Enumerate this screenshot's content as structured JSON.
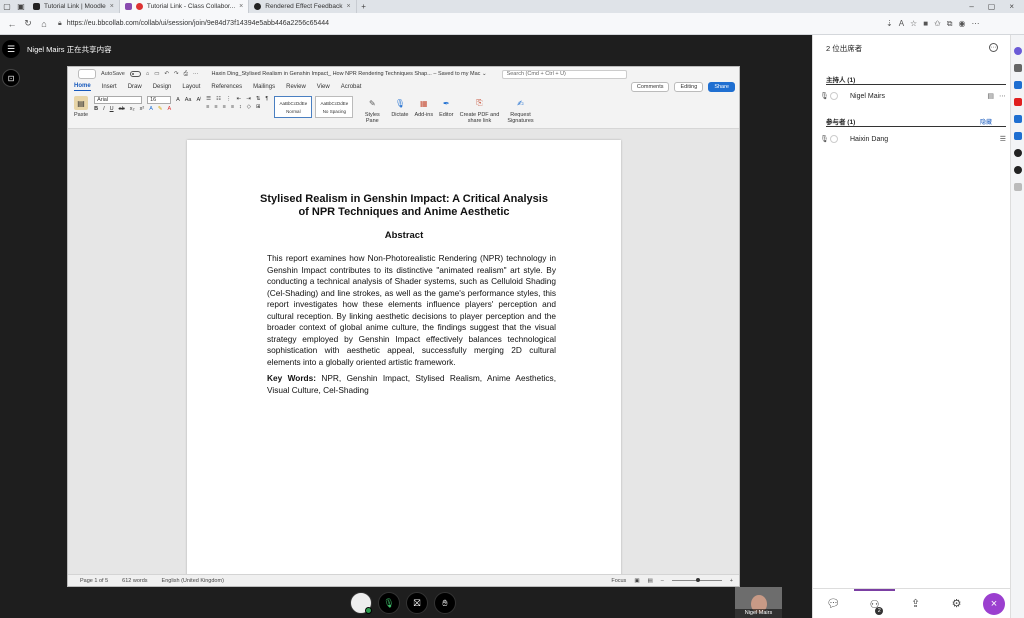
{
  "browser": {
    "tabs": [
      {
        "label": "Tutorial Link | Moodle",
        "color": "#222222"
      },
      {
        "label": "Tutorial Link - Class Collabor...",
        "color": "#8a4cb0"
      },
      {
        "label": "Rendered Effect Feedback",
        "color": "#222222"
      }
    ],
    "url": "https://eu.bbcollab.com/collab/ui/session/join/9e84d73f14394e5abb446a2256c65444"
  },
  "collab": {
    "share_label": "Nigel Mairs 正在共享内容",
    "camera_name": "Nigel Mairs"
  },
  "word": {
    "autosave": "AutoSave",
    "doc_title": "Haxin Ding_Stylised Realism in Genshin Impact_ How NPR Rendering Techniques Shap... – Saved to my Mac ⌄",
    "search_placeholder": "Search (Cmd + Ctrl + U)",
    "tabs": [
      "Home",
      "Insert",
      "Draw",
      "Design",
      "Layout",
      "References",
      "Mailings",
      "Review",
      "View",
      "Acrobat"
    ],
    "comments": "Comments",
    "editing": "Editing",
    "share": "Share",
    "font": "Arial",
    "size": "16",
    "paste": "Paste",
    "styles": [
      {
        "preview": "AaBbCcDdEe",
        "name": "Normal"
      },
      {
        "preview": "AaBbCcDdEe",
        "name": "No Spacing"
      }
    ],
    "ribbon_tools": [
      {
        "label": "Styles Pane",
        "color": "#555555"
      },
      {
        "label": "Dictate",
        "color": "#1f6fd1"
      },
      {
        "label": "Add-ins",
        "color": "#c8553d"
      },
      {
        "label": "Editor",
        "color": "#1f6fd1"
      },
      {
        "label": "Create PDF and share link",
        "color": "#c8553d"
      },
      {
        "label": "Request Signatures",
        "color": "#1f6fd1"
      }
    ],
    "document": {
      "title": "Stylised Realism in Genshin Impact: A Critical Analysis of NPR Techniques and Anime Aesthetic",
      "abstract_heading": "Abstract",
      "abstract": "This report examines how Non-Photorealistic Rendering (NPR) technology in Genshin Impact contributes to its distinctive \"animated realism\" art style. By conducting a technical analysis of Shader systems, such as Celluloid Shading (Cel-Shading) and line strokes, as well as the game's performance styles, this report investigates how these elements influence players' perception and cultural reception. By linking aesthetic decisions to player perception and the broader context of global anime culture, the findings suggest that the visual strategy employed by Genshin Impact effectively balances technological sophistication with aesthetic appeal, successfully merging 2D cultural elements into a globally oriented artistic framework.",
      "keywords_label": "Key Words:",
      "keywords": "NPR, Genshin Impact, Stylised Realism, Anime Aesthetics, Visual Culture, Cel-Shading"
    },
    "status": {
      "page": "Page 1 of 5",
      "words": "612 words",
      "language": "English (United Kingdom)",
      "focus": "Focus"
    }
  },
  "panel": {
    "header": "2 位出席者",
    "hosts_heading": "主持人 (1)",
    "participants_heading": "参与者 (1)",
    "hosts": [
      {
        "name": "Nigel Mairs"
      }
    ],
    "participants": [
      {
        "name": "Haixin Dang"
      }
    ],
    "participants_link": "隐藏",
    "attendee_count": "2"
  },
  "colors": {
    "accent": "#185abd",
    "collab_purple": "#9b3fcf"
  }
}
